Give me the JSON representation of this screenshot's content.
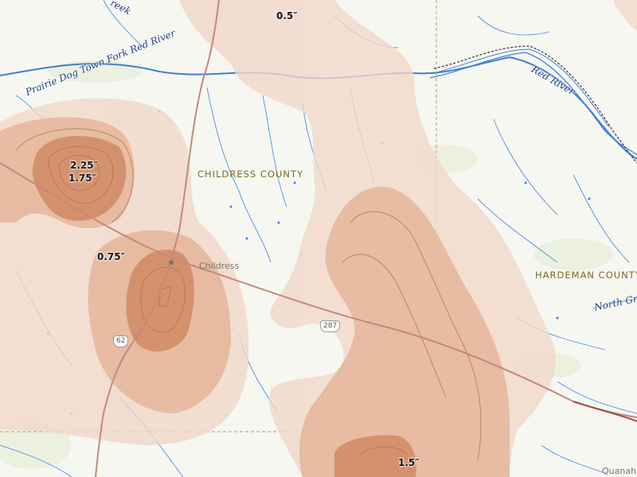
{
  "map": {
    "counties": [
      "CHILDRESS COUNTY",
      "HARDEMAN COUNTY"
    ],
    "towns": [
      "Childress",
      "Quanah"
    ],
    "rivers": [
      "Prairie Dog Town Fork Red River",
      "Red River",
      "North Gr",
      "reek"
    ],
    "highways": [
      "287",
      "62"
    ],
    "contour_labels": [
      "0.5″",
      "2.25″",
      "1.75″",
      "0.75″",
      "1.5″"
    ],
    "colors": {
      "background": "#f7f7f2",
      "water": "#3f7fd6",
      "precip_light": "#f0d8c9",
      "precip_mid": "#e3b092",
      "precip_dark": "#cf8660",
      "road": "#c7877c",
      "county_line": "#b99a52"
    }
  }
}
